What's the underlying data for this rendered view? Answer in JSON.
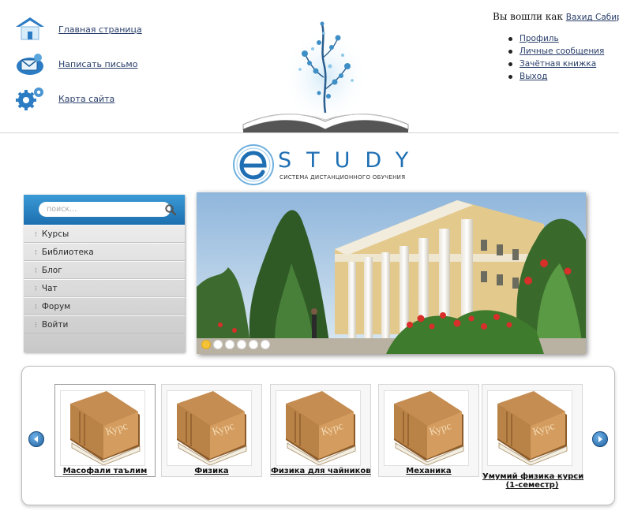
{
  "header": {
    "quick_nav": [
      {
        "label": "Главная страница",
        "icon": "home-icon"
      },
      {
        "label": "Написать письмо",
        "icon": "mail-icon"
      },
      {
        "label": "Карта сайта",
        "icon": "sitemap-gears-icon"
      }
    ],
    "user": {
      "logged_in_text": "Вы вошли как",
      "user_name": "Вахид Сабирович",
      "menu": [
        "Профиль",
        "Личные сообщения",
        "Зачётная книжка",
        "Выход"
      ]
    }
  },
  "logo": {
    "word": "STUDY",
    "subtitle": "СИСТЕМА ДИСТАНЦИОННОГО ОБУЧЕНИЯ"
  },
  "sidebar": {
    "search_placeholder": "поиск...",
    "items": [
      {
        "label": "Курсы"
      },
      {
        "label": "Библиотека"
      },
      {
        "label": "Блог"
      },
      {
        "label": "Чат"
      },
      {
        "label": "Форум"
      },
      {
        "label": "Войти"
      }
    ]
  },
  "banner": {
    "slides_total": 6,
    "active_slide": 1
  },
  "courses": {
    "book_label": "Курс",
    "items": [
      {
        "title": "Масофали таълим",
        "subtitle": ""
      },
      {
        "title": "Физика",
        "subtitle": ""
      },
      {
        "title": "Физика для чайников",
        "subtitle": ""
      },
      {
        "title": "Механика",
        "subtitle": ""
      },
      {
        "title": "Умумий физика курси",
        "subtitle": "(1-семестр)"
      }
    ]
  },
  "colors": {
    "accent_blue": "#1c6fb0",
    "book_brown": "#b98246",
    "active_dot": "#f3c236"
  }
}
